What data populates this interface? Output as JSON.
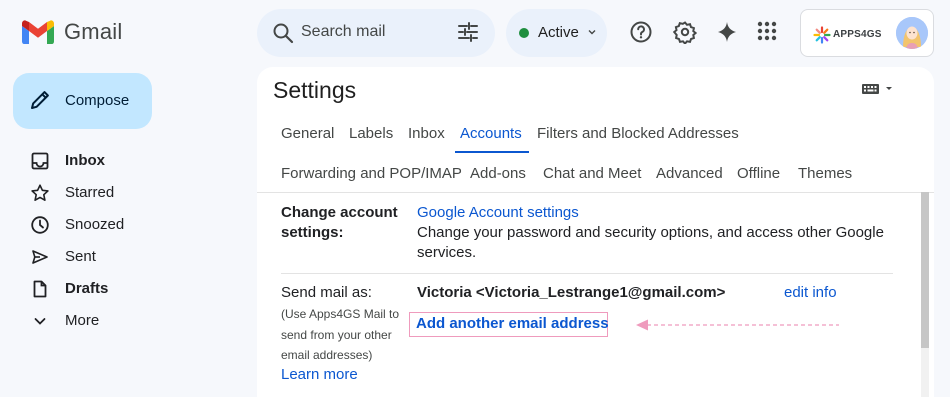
{
  "app": {
    "name": "Gmail"
  },
  "search": {
    "placeholder": "Search mail"
  },
  "status": {
    "label": "Active",
    "color": "#1e8e3e"
  },
  "account": {
    "brand": "APPS4GS"
  },
  "compose": {
    "label": "Compose"
  },
  "nav": [
    {
      "label": "Inbox",
      "icon": "inbox-icon",
      "bold": true
    },
    {
      "label": "Starred",
      "icon": "star-icon",
      "bold": false
    },
    {
      "label": "Snoozed",
      "icon": "clock-icon",
      "bold": false
    },
    {
      "label": "Sent",
      "icon": "send-icon",
      "bold": false
    },
    {
      "label": "Drafts",
      "icon": "draft-icon",
      "bold": true
    },
    {
      "label": "More",
      "icon": "chevron-down-icon",
      "bold": false
    }
  ],
  "settings": {
    "title": "Settings",
    "tabs_row1": [
      "General",
      "Labels",
      "Inbox",
      "Accounts",
      "Filters and Blocked Addresses"
    ],
    "tabs_row2": [
      "Forwarding and POP/IMAP",
      "Add-ons",
      "Chat and Meet",
      "Advanced",
      "Offline",
      "Themes"
    ],
    "active_tab": "Accounts",
    "change_account": {
      "label_line1": "Change account",
      "label_line2": "settings:",
      "link": "Google Account settings",
      "desc_line1": "Change your password and security options, and access other Google",
      "desc_line2": "services."
    },
    "send_mail_as": {
      "label": "Send mail as:",
      "note_lines": [
        "(Use Apps4GS Mail to",
        "send from your other",
        "email addresses)"
      ],
      "learn_more": "Learn more",
      "address": "Victoria <Victoria_Lestrange1@gmail.com>",
      "edit": "edit info",
      "add_link": "Add another email address"
    }
  },
  "colors": {
    "accent": "#0b57d0",
    "highlight": "#ef9bbd",
    "compose_bg": "#c2e7ff"
  }
}
